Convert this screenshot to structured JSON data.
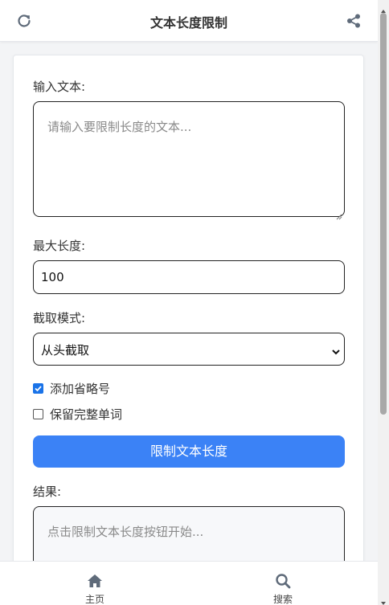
{
  "header": {
    "title": "文本长度限制",
    "left_icon": "refresh-icon",
    "right_icon": "share-icon"
  },
  "form": {
    "input_label": "输入文本:",
    "input_placeholder": "请输入要限制长度的文本...",
    "max_length_label": "最大长度:",
    "max_length_value": "100",
    "mode_label": "截取模式:",
    "mode_selected": "从头截取",
    "ellipsis_label": "添加省略号",
    "ellipsis_checked": true,
    "keep_words_label": "保留完整单词",
    "keep_words_checked": false,
    "submit_label": "限制文本长度",
    "result_label": "结果:",
    "result_placeholder": "点击限制文本长度按钮开始..."
  },
  "bottom_nav": {
    "items": [
      {
        "label": "主页",
        "icon": "home-icon"
      },
      {
        "label": "搜索",
        "icon": "search-icon"
      }
    ]
  },
  "colors": {
    "accent": "#3b82f6",
    "checkbox": "#1a73e8",
    "icon": "#5f6b7a"
  }
}
